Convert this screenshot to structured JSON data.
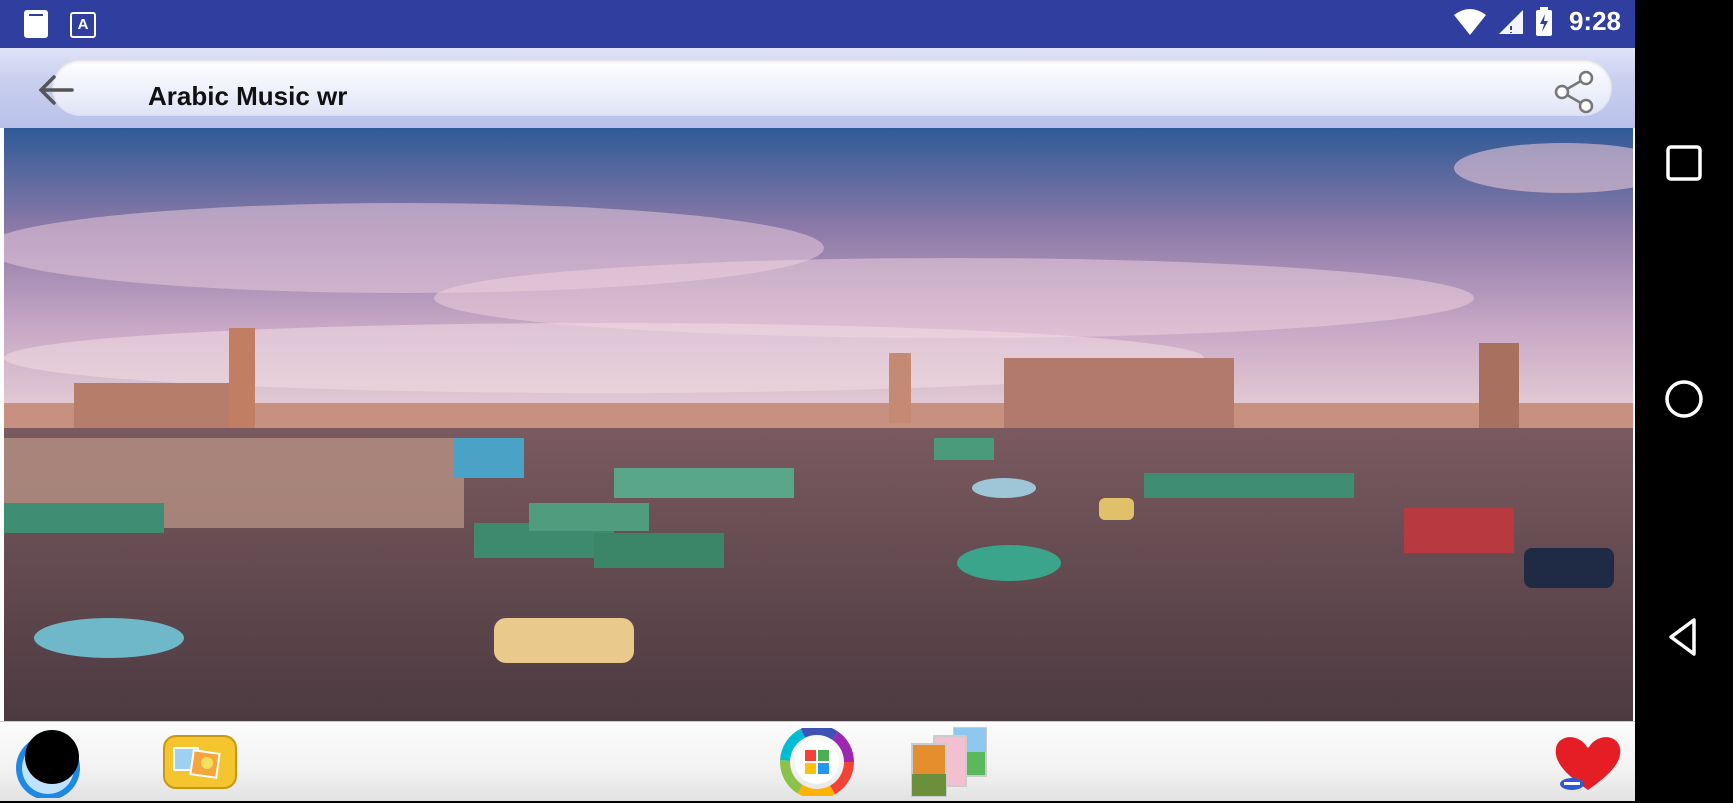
{
  "status_bar": {
    "time": "9:28",
    "left_icons": [
      "sd-card-icon",
      "text-a-icon"
    ],
    "right_icons": [
      "wifi-icon",
      "signal-icon",
      "battery-icon"
    ]
  },
  "toolbar": {
    "title": "Arabic Music wr",
    "back_icon": "arrow-left-icon",
    "share_icon": "share-icon"
  },
  "photo": {
    "subject": "panorama of a busy market square with stalls and green umbrellas under a pink-blue sky"
  },
  "bottom_bar": {
    "items": [
      {
        "name": "settings-dial-button",
        "icon": "black-circle-icon"
      },
      {
        "name": "gallery-button",
        "icon": "photo-album-icon"
      },
      {
        "name": "color-picker-button",
        "icon": "color-wheel-icon"
      },
      {
        "name": "wallpapers-button",
        "icon": "image-stack-icon"
      },
      {
        "name": "favorite-button",
        "icon": "heart-icon"
      }
    ]
  },
  "nav_bar": {
    "icons": [
      "square-recents-icon",
      "circle-home-icon",
      "triangle-back-icon"
    ]
  },
  "colors": {
    "status_bar": "#303f9f",
    "toolbar": "#c9d0ef",
    "nav_bar": "#000000"
  }
}
